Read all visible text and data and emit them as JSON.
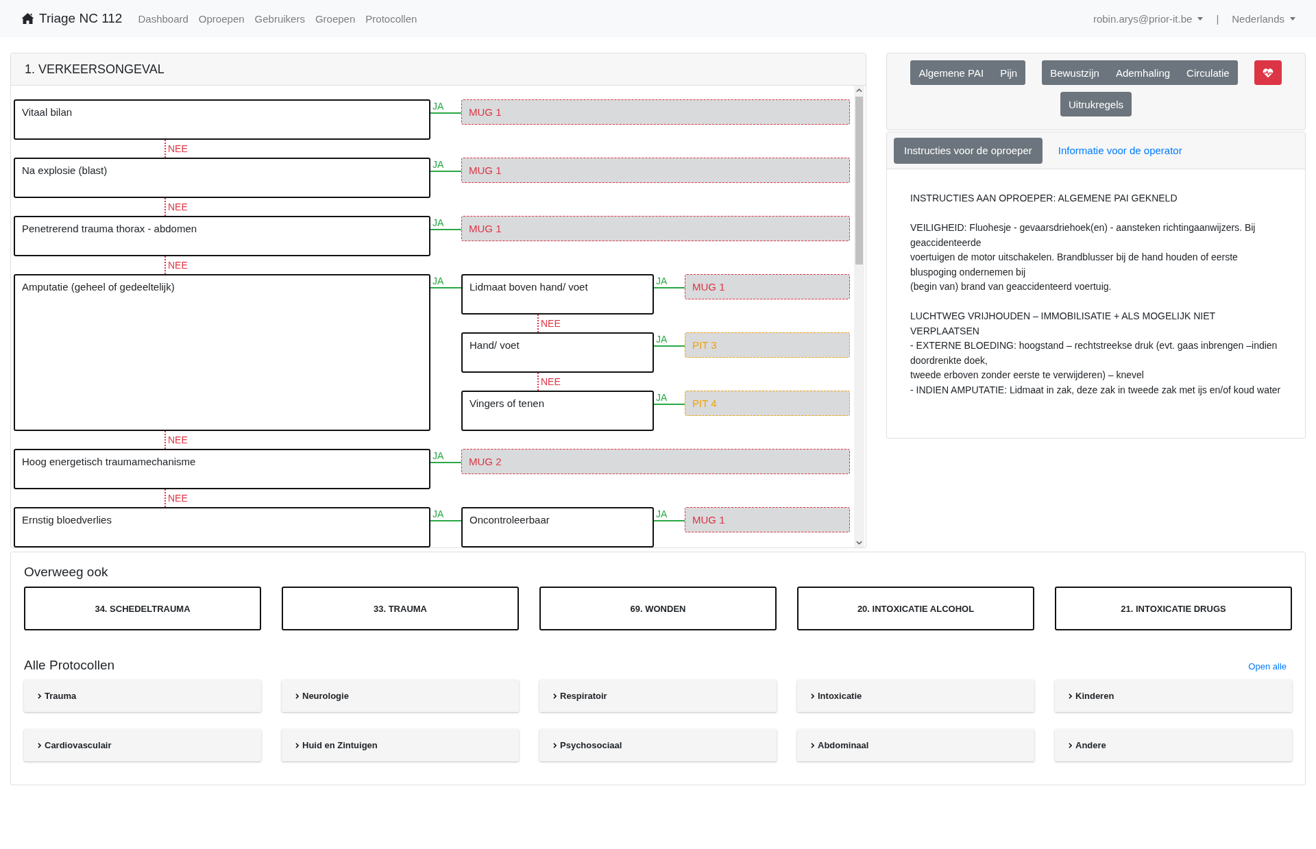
{
  "navbar": {
    "brand": "Triage NC 112",
    "links": [
      {
        "label": "Dashboard"
      },
      {
        "label": "Oproepen"
      },
      {
        "label": "Gebruikers"
      },
      {
        "label": "Groepen"
      },
      {
        "label": "Protocollen"
      }
    ],
    "user": "robin.arys@prior-it.be",
    "separator": "|",
    "language": "Nederlands"
  },
  "protocol": {
    "title": "1. VERKEERSONGEVAL",
    "questions": [
      {
        "text": "Vitaal bilan",
        "yes": "JA",
        "outcome": {
          "text": "MUG 1",
          "color": "#dc3545"
        }
      },
      {
        "text": "Na explosie (blast)",
        "no_above": "NEE",
        "yes": "JA",
        "outcome": {
          "text": "MUG 1",
          "color": "#dc3545"
        }
      },
      {
        "text": "Penetrerend trauma thorax - abdomen",
        "no_above": "NEE",
        "yes": "JA",
        "outcome": {
          "text": "MUG 1",
          "color": "#dc3545"
        }
      },
      {
        "text": "Amputatie (geheel of gedeeltelijk)",
        "no_above": "NEE",
        "yes": "JA",
        "children": [
          {
            "text": "Lidmaat boven hand/ voet",
            "yes": "JA",
            "outcome": {
              "text": "MUG 1",
              "color": "#dc3545"
            }
          },
          {
            "text": "Hand/ voet",
            "no_above": "NEE",
            "yes": "JA",
            "outcome": {
              "text": "PIT 3",
              "color": "#f0a30a"
            }
          },
          {
            "text": "Vingers of tenen",
            "no_above": "NEE",
            "yes": "JA",
            "outcome": {
              "text": "PIT 4",
              "color": "#f0a30a"
            }
          }
        ]
      },
      {
        "text": "Hoog energetisch traumamechanisme",
        "no_above": "NEE",
        "yes": "JA",
        "outcome": {
          "text": "MUG 2",
          "color": "#dc3545"
        }
      },
      {
        "text": "Ernstig bloedverlies",
        "no_above": "NEE",
        "yes": "JA",
        "children": [
          {
            "text": "Oncontroleerbaar",
            "yes": "JA",
            "outcome": {
              "text": "MUG 1",
              "color": "#dc3545"
            }
          }
        ]
      }
    ]
  },
  "toolbar": [
    {
      "kind": "group",
      "buttons": [
        "Algemene PAI",
        "Pijn"
      ]
    },
    {
      "kind": "group",
      "buttons": [
        "Bewustzijn",
        "Ademhaling",
        "Circulatie"
      ]
    },
    {
      "kind": "heart"
    },
    {
      "kind": "group",
      "buttons": [
        "Uitrukregels"
      ]
    }
  ],
  "instructions": {
    "tabs": [
      {
        "label": "Instructies voor de oproeper",
        "selected": true
      },
      {
        "label": "Informatie voor de operator",
        "selected": false
      }
    ],
    "paragraphs": [
      [
        "INSTRUCTIES AAN OPROEPER: ALGEMENE PAI GEKNELD"
      ],
      [
        "VEILIGHEID: Fluohesje - gevaarsdriehoek(en) - aansteken richtingaanwijzers. Bij geaccidenteerde",
        "voertuigen de motor uitschakelen. Brandblusser bij de hand houden of eerste bluspoging ondernemen bij",
        "(begin van) brand van geaccidenteerd voertuig."
      ],
      [
        "LUCHTWEG VRIJHOUDEN – IMMOBILISATIE + ALS MOGELIJK NIET VERPLAATSEN",
        "- EXTERNE BLOEDING: hoogstand – rechtstreekse druk (evt. gaas inbrengen –indien doordrenkte doek,",
        "tweede erboven zonder eerste te verwijderen) – knevel",
        "- INDIEN AMPUTATIE: Lidmaat in zak, deze zak in tweede zak met ijs en/of koud water"
      ]
    ]
  },
  "consider": {
    "title": "Overweeg ook",
    "items": [
      "34. SCHEDELTRAUMA",
      "33. TRAUMA",
      "69. WONDEN",
      "20. INTOXICATIE ALCOHOL",
      "21. INTOXICATIE DRUGS"
    ]
  },
  "all_protocols": {
    "title": "Alle Protocollen",
    "open_all": "Open alle",
    "categories": [
      "Trauma",
      "Neurologie",
      "Respiratoir",
      "Intoxicatie",
      "Kinderen",
      "Cardiovasculair",
      "Huid en Zintuigen",
      "Psychosociaal",
      "Abdominaal",
      "Andere"
    ]
  }
}
